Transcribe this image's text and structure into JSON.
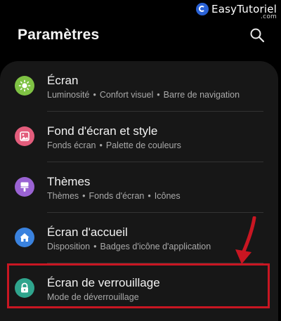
{
  "watermark": {
    "brand": "EasyTutoriel",
    "suffix": ".com"
  },
  "header": {
    "title": "Paramètres",
    "search_icon": "search-icon"
  },
  "settings": [
    {
      "title": "Écran",
      "subtitle": [
        "Luminosité",
        "Confort visuel",
        "Barre de navigation"
      ],
      "icon": "sun-icon",
      "color": "#7fc244"
    },
    {
      "title": "Fond d'écran et style",
      "subtitle": [
        "Fonds écran",
        "Palette de couleurs"
      ],
      "icon": "image-icon",
      "color": "#e35d7c"
    },
    {
      "title": "Thèmes",
      "subtitle": [
        "Thèmes",
        "Fonds d'écran",
        "Icônes"
      ],
      "icon": "brush-icon",
      "color": "#9a63d3"
    },
    {
      "title": "Écran d'accueil",
      "subtitle": [
        "Disposition",
        "Badges d'icône d'application"
      ],
      "icon": "home-icon",
      "color": "#3a82de"
    },
    {
      "title": "Écran de verrouillage",
      "subtitle": [
        "Mode de déverrouillage"
      ],
      "icon": "lock-icon",
      "color": "#2fa58d"
    }
  ],
  "annotation": {
    "color": "#c81622",
    "highlighted_item": "Écran de verrouillage"
  }
}
